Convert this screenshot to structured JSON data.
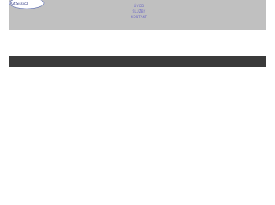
{
  "header": {
    "logo_text": "Kat.Sissi.cz",
    "nav": [
      {
        "label": "ÚVOD"
      },
      {
        "label": "SLUŽBY"
      },
      {
        "label": "KONTAKT"
      }
    ]
  },
  "colors": {
    "header_bg": "#c0c0c0",
    "nav_link": "#6b67c6",
    "dark_bar": "#3a3a3a",
    "page_bg": "#ffffff"
  }
}
